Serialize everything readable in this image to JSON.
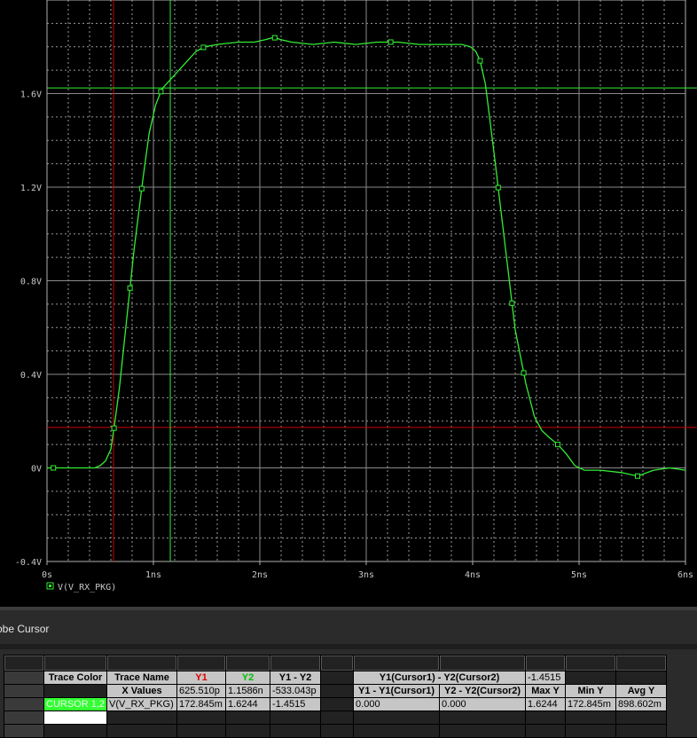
{
  "chart_data": {
    "type": "line",
    "title": "",
    "xlabel": "",
    "ylabel": "",
    "xlim": [
      0,
      6
    ],
    "ylim": [
      -0.4,
      2.0
    ],
    "x_unit": "ns",
    "x_ticks": [
      {
        "v": 0,
        "label": "0s"
      },
      {
        "v": 1,
        "label": "1ns"
      },
      {
        "v": 2,
        "label": "2ns"
      },
      {
        "v": 3,
        "label": "3ns"
      },
      {
        "v": 4,
        "label": "4ns"
      },
      {
        "v": 5,
        "label": "5ns"
      },
      {
        "v": 6,
        "label": "6ns"
      }
    ],
    "y_ticks": [
      {
        "v": 1.6,
        "label": "1.6V"
      },
      {
        "v": 1.2,
        "label": "1.2V"
      },
      {
        "v": 0.8,
        "label": "0.8V"
      },
      {
        "v": 0.4,
        "label": "0.4V"
      },
      {
        "v": 0.0,
        "label": "0V"
      },
      {
        "v": -0.4,
        "label": "-0.4V"
      }
    ],
    "grid": true,
    "legend": "bottom-left",
    "series": [
      {
        "name": "V(V_RX_PKG)",
        "color": "#33ee33",
        "x": [
          0.0,
          0.45,
          0.5,
          0.55,
          0.6,
          0.63,
          0.68,
          0.75,
          0.82,
          0.9,
          0.96,
          1.02,
          1.08,
          1.14,
          1.2,
          1.3,
          1.4,
          1.48,
          1.6,
          1.8,
          1.95,
          2.05,
          2.13,
          2.2,
          2.3,
          2.5,
          2.7,
          2.9,
          3.1,
          3.3,
          3.5,
          3.7,
          3.9,
          3.98,
          4.03,
          4.07,
          4.12,
          4.2,
          4.3,
          4.4,
          4.5,
          4.58,
          4.65,
          4.72,
          4.8,
          4.88,
          4.96,
          5.05,
          5.2,
          5.4,
          5.55,
          5.7,
          5.85,
          6.0
        ],
        "y": [
          0.0,
          0.0,
          0.01,
          0.03,
          0.08,
          0.17,
          0.34,
          0.64,
          0.94,
          1.23,
          1.43,
          1.55,
          1.62,
          1.65,
          1.68,
          1.73,
          1.78,
          1.8,
          1.81,
          1.82,
          1.82,
          1.83,
          1.84,
          1.83,
          1.82,
          1.81,
          1.82,
          1.81,
          1.82,
          1.82,
          1.81,
          1.81,
          1.81,
          1.8,
          1.78,
          1.74,
          1.64,
          1.35,
          0.97,
          0.59,
          0.36,
          0.22,
          0.16,
          0.13,
          0.1,
          0.06,
          0.01,
          -0.01,
          -0.01,
          -0.02,
          -0.035,
          -0.01,
          0.0,
          -0.01
        ]
      }
    ],
    "cursors": [
      {
        "name": "Y1",
        "x": 0.6255,
        "y": 0.1728,
        "color": "#cc0000"
      },
      {
        "name": "Y2",
        "x": 1.1586,
        "y": 1.6244,
        "color": "#33ee33"
      }
    ],
    "marker_x": [
      0.06,
      0.63,
      0.78,
      0.89,
      1.07,
      1.47,
      2.14,
      3.23,
      4.07,
      4.24,
      4.37,
      4.48,
      4.8,
      5.55
    ]
  },
  "cursor_panel": {
    "title": "obe Cursor",
    "headers": {
      "trace_color": "Trace Color",
      "trace_name": "Trace Name",
      "y1": "Y1",
      "y2": "Y2",
      "y1_minus_y2": "Y1 - Y2",
      "y1c1_minus_y2c2": "Y1(Cursor1) - Y2(Cursor2)",
      "diff_value": "-1.4515"
    },
    "x_row": {
      "label": "X Values",
      "y1": "625.510p",
      "y2": "1.1586n",
      "y1_minus_y2": "-533.043p",
      "y1_y1c1": "Y1 - Y1(Cursor1)",
      "y2_y2c2": "Y2 - Y2(Cursor2)",
      "max_y": "Max Y",
      "min_y": "Min Y",
      "avg_y": "Avg Y"
    },
    "data_row": {
      "trace_color": "CURSOR 1,2",
      "trace_name": "V(V_RX_PKG)",
      "y1": "172.845m",
      "y2": "1.6244",
      "y1_minus_y2": "-1.4515",
      "y1_y1c1": "0.000",
      "y2_y2c2": "0.000",
      "max_y": "1.6244",
      "min_y": "172.845m",
      "avg_y": "898.602m"
    }
  }
}
